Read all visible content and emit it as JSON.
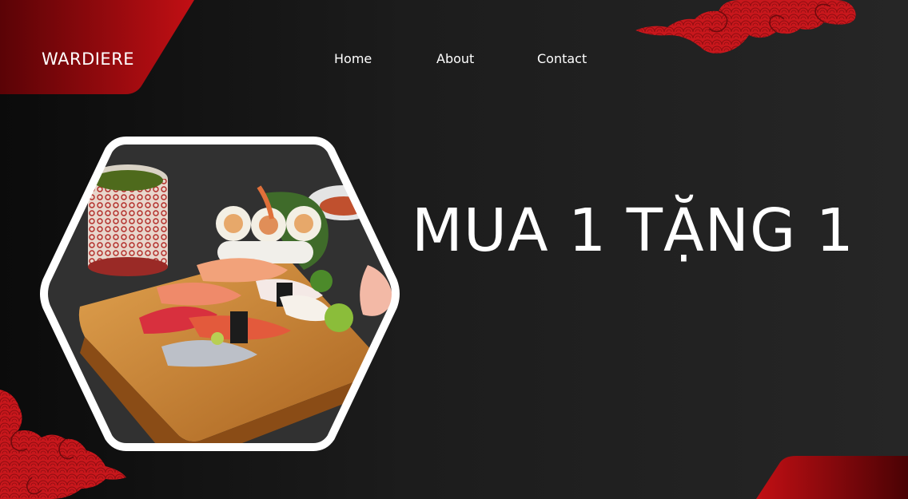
{
  "brand": {
    "name": "WARDIERE",
    "accent": "#b80f14",
    "accent_dark": "#5a0306"
  },
  "nav": {
    "items": [
      {
        "label": "Home"
      },
      {
        "label": "About"
      },
      {
        "label": "Contact"
      }
    ]
  },
  "hero": {
    "headline": "MUA 1 TẶNG 1",
    "image_icon": "sushi-platter-image",
    "frame_shape": "hexagon",
    "frame_color": "#ffffff"
  },
  "decorations": {
    "cloud_icon": "red-cloud-pattern",
    "cloud_color": "#c8171c"
  }
}
